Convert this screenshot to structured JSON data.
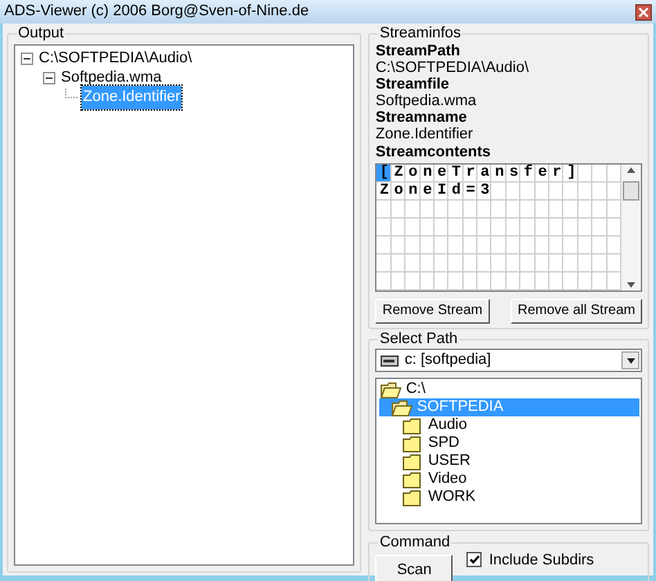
{
  "window": {
    "title": "ADS-Viewer (c) 2006 Borg@Sven-of-Nine.de"
  },
  "output": {
    "label": "Output",
    "tree": [
      {
        "label": "C:\\SOFTPEDIA\\Audio\\",
        "expanded": true,
        "selected": false,
        "children": [
          {
            "label": "Softpedia.wma",
            "expanded": true,
            "selected": false,
            "children": [
              {
                "label": "Zone.Identifier",
                "selected": true
              }
            ]
          }
        ]
      }
    ]
  },
  "streaminfos": {
    "label": "Streaminfos",
    "fields": [
      {
        "label": "StreamPath",
        "value": "C:\\SOFTPEDIA\\Audio\\"
      },
      {
        "label": "Streamfile",
        "value": "Softpedia.wma"
      },
      {
        "label": "Streamname",
        "value": "Zone.Identifier"
      }
    ],
    "contents_label": "Streamcontents",
    "contents": [
      {
        "text": "[ZoneTransfer]",
        "cursor": true
      },
      {
        "text": "ZoneId=3",
        "cursor": false
      }
    ],
    "buttons": [
      "Remove Stream",
      "Remove all Stream"
    ]
  },
  "select_path": {
    "label": "Select Path",
    "drive": "c: [softpedia]",
    "folders": [
      {
        "label": "C:\\",
        "open": true,
        "selected": false,
        "children": [
          {
            "label": "SOFTPEDIA",
            "open": true,
            "selected": true,
            "children": [
              {
                "label": "Audio",
                "open": false,
                "selected": false
              },
              {
                "label": "SPD",
                "open": false,
                "selected": false
              },
              {
                "label": "USER",
                "open": false,
                "selected": false
              },
              {
                "label": "Video",
                "open": false,
                "selected": false
              },
              {
                "label": "WORK",
                "open": false,
                "selected": false
              }
            ]
          }
        ]
      }
    ]
  },
  "command": {
    "label": "Command",
    "button": "Scan",
    "include_subdirs": {
      "label": "Include Subdirs",
      "checked": true
    }
  }
}
